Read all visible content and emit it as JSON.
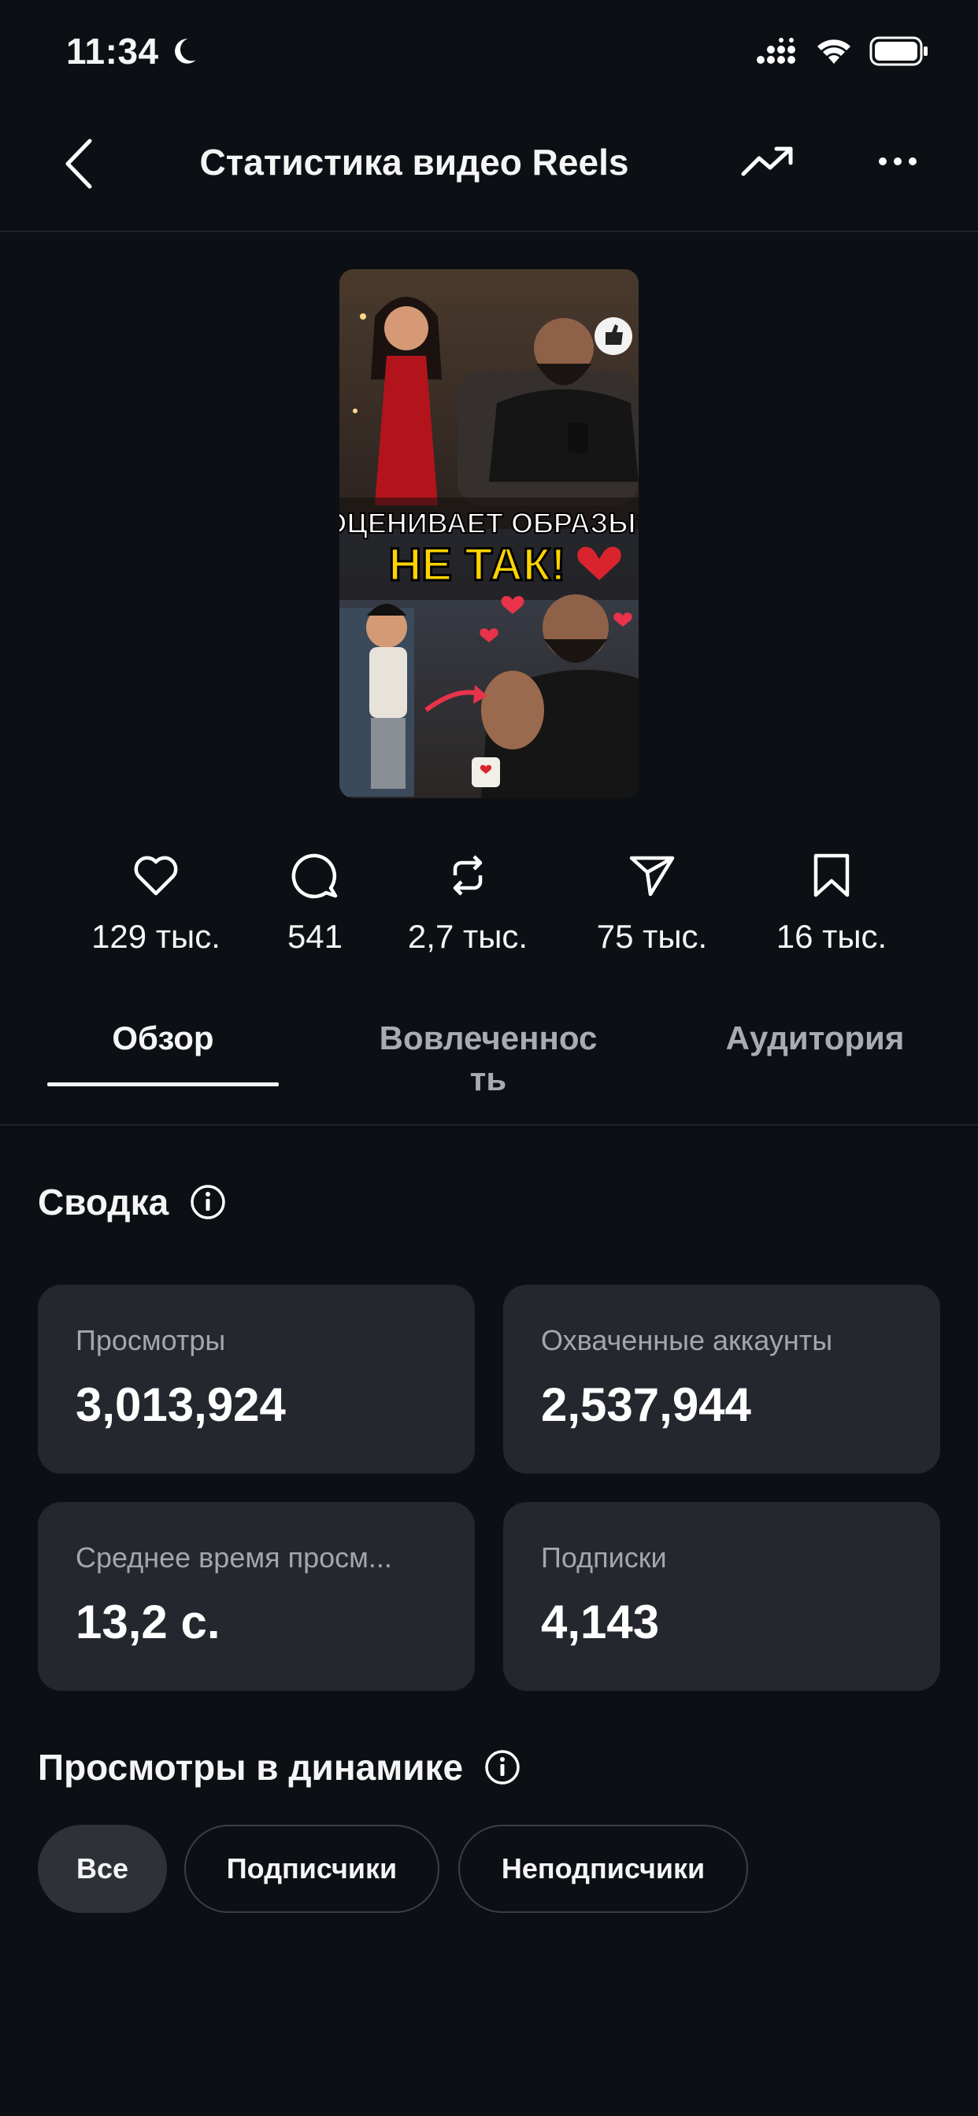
{
  "status_bar": {
    "time": "11:34",
    "icons": [
      "moon-icon",
      "signal-icon",
      "wifi-icon",
      "battery-icon"
    ]
  },
  "nav": {
    "title": "Статистика видео Reels",
    "icons": [
      "back-chevron-icon",
      "trending-up-icon",
      "more-dots-icon"
    ]
  },
  "thumbnail": {
    "caption_line1": "ОЦЕНИВАЕТ ОБРАЗЫ?",
    "caption_line2": "НЕ ТАК!"
  },
  "metrics": [
    {
      "icon": "heart-icon",
      "value": "129 тыс."
    },
    {
      "icon": "comment-icon",
      "value": "541"
    },
    {
      "icon": "repost-icon",
      "value": "2,7 тыс."
    },
    {
      "icon": "send-icon",
      "value": "75 тыс."
    },
    {
      "icon": "bookmark-icon",
      "value": "16 тыс."
    }
  ],
  "tabs": [
    {
      "label": "Обзор",
      "active": true
    },
    {
      "label_line1": "Вовлеченнос",
      "label_line2": "ть",
      "active": false
    },
    {
      "label": "Аудитория",
      "active": false
    }
  ],
  "summary": {
    "title": "Сводка",
    "cards": [
      {
        "label": "Просмотры",
        "value": "3,013,924"
      },
      {
        "label": "Охваченные аккаунты",
        "value": "2,537,944"
      },
      {
        "label": "Среднее время просм...",
        "value": "13,2 с."
      },
      {
        "label": "Подписки",
        "value": "4,143"
      }
    ]
  },
  "views_dynamics": {
    "title": "Просмотры в динамике",
    "chips": [
      {
        "label": "Все",
        "selected": true
      },
      {
        "label": "Подписчики",
        "selected": false
      },
      {
        "label": "Неподписчики",
        "selected": false
      }
    ]
  },
  "colors": {
    "background": "#0c1014",
    "card": "#24282e",
    "muted_text": "#a2a7ad",
    "caption_yellow": "#ffd400",
    "dress_red": "#b3141c"
  }
}
